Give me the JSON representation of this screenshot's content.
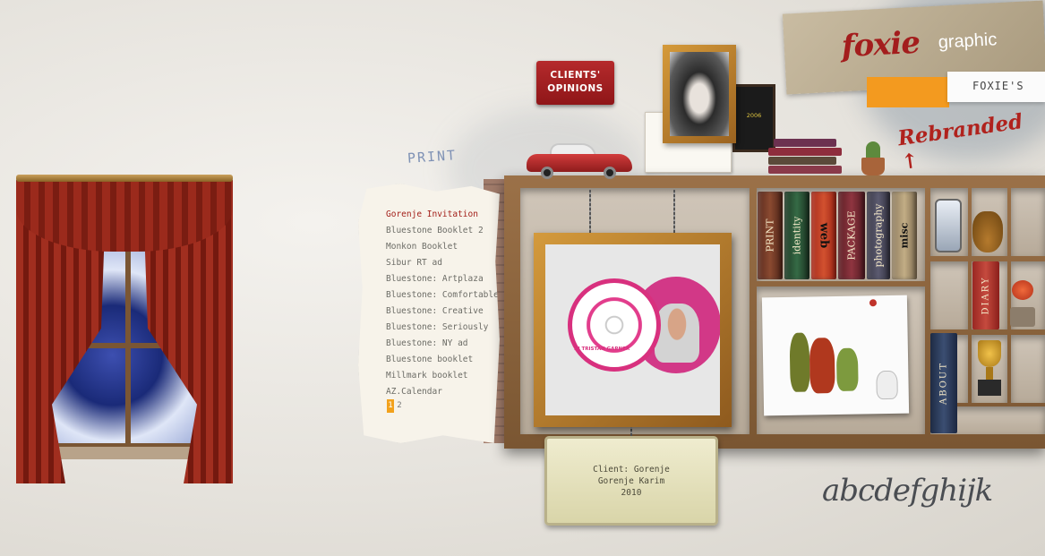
{
  "brand": {
    "logo_mark": "foxie",
    "logo_word": "graphic",
    "foxies_link": "FOXIE'S",
    "rebranded": "Rebranded"
  },
  "section_label": "PRINT",
  "clients_button": {
    "line1": "CLIENTS'",
    "line2": "OPINIONS"
  },
  "projects": [
    {
      "label": "Gorenje Invitation",
      "active": true
    },
    {
      "label": "Bluestone Booklet 2",
      "active": false
    },
    {
      "label": "Monkon Booklet",
      "active": false
    },
    {
      "label": "Sibur RT ad",
      "active": false
    },
    {
      "label": "Bluestone: Artplaza",
      "active": false
    },
    {
      "label": "Bluestone: Comfortable",
      "active": false
    },
    {
      "label": "Bluestone: Creative",
      "active": false
    },
    {
      "label": "Bluestone: Seriously",
      "active": false
    },
    {
      "label": "Bluestone: NY ad",
      "active": false
    },
    {
      "label": "Bluestone booklet",
      "active": false
    },
    {
      "label": "Millmark booklet",
      "active": false
    },
    {
      "label": "AZ.Calendar",
      "active": false
    }
  ],
  "pager": {
    "pages": [
      "1",
      "2"
    ],
    "current": "1"
  },
  "books": {
    "print": "PRINT",
    "identity": "identity",
    "web": "web",
    "package": "PACKAGE",
    "photography": "photography",
    "misc": "misc",
    "diary": "DIARY",
    "about": "ABOUT"
  },
  "portfolio_item": {
    "cd_caption": "DJ TRISTAN GARNER"
  },
  "award_text": "2006",
  "caption": {
    "line1": "Client: Gorenje",
    "line2": "Gorenje Karim",
    "line3": "2010"
  },
  "calligraphy": "abcdefghijk",
  "colors": {
    "accent_red": "#a31d1d",
    "accent_orange": "#f39a1f",
    "active_item": "#a3201a",
    "menu_text": "#6c6c66"
  }
}
